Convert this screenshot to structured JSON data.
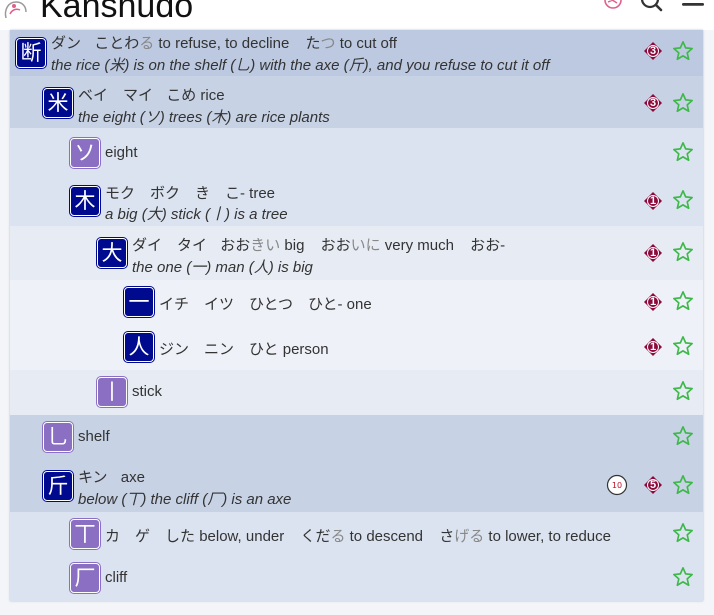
{
  "app": {
    "title": "Kanshudo"
  },
  "colors": {
    "kanji_badge": "#000a8f",
    "radical_badge": "#8a6fc2",
    "count_badge": "#8c0a3c",
    "star_outline": "#3fb84a",
    "logo_pink": "#e0608a"
  },
  "icons": {
    "header": [
      "logo-icon",
      "settings-icon",
      "search-icon",
      "menu-icon"
    ],
    "row_action": "star-icon",
    "count": "diamond-count-icon",
    "frequency": "frequency-icon"
  },
  "rows": [
    {
      "char": "断",
      "kind": "kanji",
      "count": "3",
      "on": "ダン",
      "kun": [
        {
          "kana": "ことわ",
          "okuri": "る",
          "meaning": "to refuse, to decline"
        },
        {
          "kana": "た",
          "okuri": "つ",
          "meaning": "to cut off"
        }
      ],
      "mnemonic": "the rice (米) is on the shelf (乚) with the axe (斤), and you refuse to cut it off"
    },
    {
      "char": "米",
      "kind": "kanji",
      "count": "3",
      "on": "ベイ　マイ",
      "kun": [
        {
          "kana": "こめ",
          "okuri": "",
          "meaning": "rice"
        }
      ],
      "mnemonic": "the eight (ソ) trees (木) are rice plants"
    },
    {
      "char": "ソ",
      "kind": "radical",
      "meaning": "eight"
    },
    {
      "char": "木",
      "kind": "kanji",
      "count": "1",
      "on": "モク　ボク　き　こ-",
      "meaning": "tree",
      "mnemonic": "a big (大) stick (丨) is a tree"
    },
    {
      "char": "大",
      "kind": "kanji",
      "count": "1",
      "on": "ダイ　タイ",
      "kun": [
        {
          "kana": "おお",
          "okuri": "きい",
          "meaning": "big"
        },
        {
          "kana": "おお",
          "okuri": "いに",
          "meaning": "very much"
        },
        {
          "kana": "おお-",
          "okuri": "",
          "meaning": ""
        }
      ],
      "mnemonic": "the one (一) man (人) is big"
    },
    {
      "char": "一",
      "kind": "kanji",
      "count": "1",
      "text": "イチ　イツ　ひとつ　ひと-",
      "meaning": "one"
    },
    {
      "char": "人",
      "kind": "kanji",
      "count": "1",
      "text": "ジン　ニン　ひと",
      "meaning": "person"
    },
    {
      "char": "丨",
      "kind": "radical",
      "meaning": "stick"
    },
    {
      "char": "乚",
      "kind": "radical",
      "meaning": "shelf"
    },
    {
      "char": "斤",
      "kind": "kanji",
      "count": "5",
      "freq": "10",
      "on": "キン",
      "meaning": "axe",
      "mnemonic": "below (丅) the cliff (厂) is an axe"
    },
    {
      "char": "丅",
      "kind": "radical",
      "text": "カ　ゲ　した",
      "meaning": "below, under",
      "kun": [
        {
          "kana": "くだ",
          "okuri": "る",
          "meaning": "to descend"
        },
        {
          "kana": "さ",
          "okuri": "げる",
          "meaning": "to lower, to reduce"
        }
      ]
    },
    {
      "char": "厂",
      "kind": "radical",
      "meaning": "cliff"
    }
  ]
}
